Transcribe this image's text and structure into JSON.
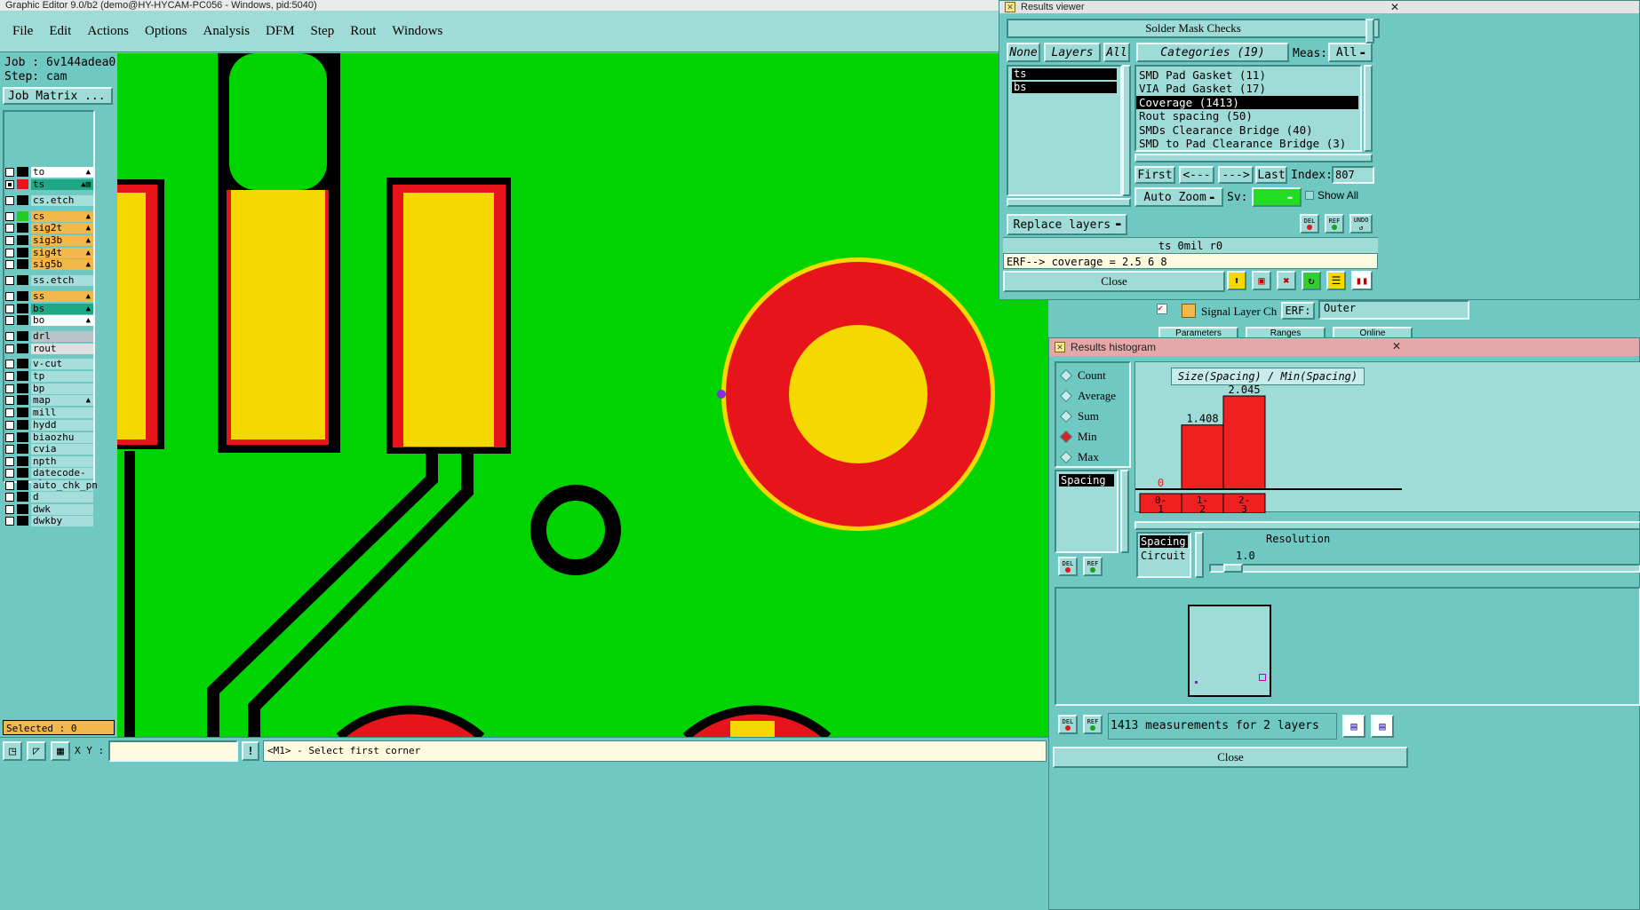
{
  "app": {
    "title": "Graphic Editor 9.0/b2 (demo@HY-HYCAM-PC056 - Windows, pid:5040)"
  },
  "menu": [
    "File",
    "Edit",
    "Actions",
    "Options",
    "Analysis",
    "DFM",
    "Step",
    "Rout",
    "Windows"
  ],
  "job": {
    "job_label": "Job : 6v144adea0",
    "step_label": "Step: cam",
    "matrix_button": "Job Matrix ..."
  },
  "layers": [
    {
      "name": "to",
      "color": "#ffffff",
      "sw": "#000000",
      "tag": "▲"
    },
    {
      "name": "ts",
      "color": "#1fa883",
      "sw": "#e8141b",
      "tag": "▲▧",
      "checked": true
    },
    {
      "name": "cs.etch",
      "color": "#a5dedb",
      "sw": "#000000",
      "tag": ""
    },
    {
      "name": "cs",
      "color": "#f2b84c",
      "sw": "#22cc22",
      "tag": "▲"
    },
    {
      "name": "sig2t",
      "color": "#f2b84c",
      "sw": "#000000",
      "tag": "▲"
    },
    {
      "name": "sig3b",
      "color": "#f2b84c",
      "sw": "#000000",
      "tag": "▲"
    },
    {
      "name": "sig4t",
      "color": "#f2b84c",
      "sw": "#000000",
      "tag": "▲"
    },
    {
      "name": "sig5b",
      "color": "#f2b84c",
      "sw": "#000000",
      "tag": "▲"
    },
    {
      "name": "ss.etch",
      "color": "#a5dedb",
      "sw": "#000000",
      "tag": ""
    },
    {
      "name": "ss",
      "color": "#f2b84c",
      "sw": "#000000",
      "tag": "▲"
    },
    {
      "name": "bs",
      "color": "#1fa883",
      "sw": "#000000",
      "tag": "▲"
    },
    {
      "name": "bo",
      "color": "#ffffff",
      "sw": "#000000",
      "tag": "▲"
    },
    {
      "name": "drl",
      "color": "#b8c4c6",
      "sw": "#000000",
      "tag": ""
    },
    {
      "name": "rout",
      "color": "#e0e0e0",
      "sw": "#000000",
      "tag": ""
    },
    {
      "name": "v-cut",
      "color": "#a5dedb",
      "sw": "#000000",
      "tag": ""
    },
    {
      "name": "tp",
      "color": "#a5dedb",
      "sw": "#000000",
      "tag": ""
    },
    {
      "name": "bp",
      "color": "#a5dedb",
      "sw": "#000000",
      "tag": ""
    },
    {
      "name": "map",
      "color": "#a5dedb",
      "sw": "#000000",
      "tag": "▲"
    },
    {
      "name": "mill",
      "color": "#a5dedb",
      "sw": "#000000",
      "tag": ""
    },
    {
      "name": "hydd",
      "color": "#a5dedb",
      "sw": "#000000",
      "tag": ""
    },
    {
      "name": "biaozhu",
      "color": "#a5dedb",
      "sw": "#000000",
      "tag": ""
    },
    {
      "name": "cvia",
      "color": "#a5dedb",
      "sw": "#000000",
      "tag": ""
    },
    {
      "name": "npth",
      "color": "#a5dedb",
      "sw": "#000000",
      "tag": ""
    },
    {
      "name": "datecode-pbe",
      "color": "#a5dedb",
      "sw": "#000000",
      "tag": ""
    },
    {
      "name": "auto_chk_pn",
      "color": "#a5dedb",
      "sw": "#000000",
      "tag": ""
    },
    {
      "name": "d",
      "color": "#a5dedb",
      "sw": "#000000",
      "tag": ""
    },
    {
      "name": "dwk",
      "color": "#a5dedb",
      "sw": "#000000",
      "tag": ""
    },
    {
      "name": "dwkby",
      "color": "#a5dedb",
      "sw": "#000000",
      "tag": ""
    }
  ],
  "status": {
    "selected": "Selected : 0",
    "xy_label": "X Y :",
    "xy_value": "",
    "prompt": "<M1> - Select first corner"
  },
  "results_viewer": {
    "title": "Results viewer",
    "header": "Solder Mask Checks",
    "none_btn": "None",
    "layers_btn": "Layers",
    "all_btn": "All",
    "layer_list": [
      "ts",
      "bs"
    ],
    "categories_label": "Categories (19)",
    "meas_label": "Meas:",
    "meas_value": "All",
    "categories": [
      "SMD Pad Gasket (11)",
      "VIA Pad Gasket (17)",
      "Coverage (1413)",
      "Rout spacing (50)",
      "SMDs Clearance Bridge (40)",
      "SMD to Pad Clearance Bridge (3)"
    ],
    "selected_category": 2,
    "first": "First",
    "prev": "<---",
    "next": "--->",
    "last": "Last",
    "index_label": "Index:",
    "index_value": "807",
    "auto_zoom": "Auto Zoom",
    "sv_label": "Sv:",
    "show_all": "Show All",
    "replace_layers": "Replace layers",
    "del": "DEL",
    "ref": "REF",
    "undo": "UNDO",
    "info_line": "ts 0mil  r0",
    "erf_line": "ERF--> coverage = 2.5 6 8",
    "close": "Close"
  },
  "signal_strip": {
    "name": "Signal Layer Ch",
    "erf_label": "ERF:",
    "erf_value": "Outer",
    "tabs": [
      "Parameters",
      "Ranges",
      "Online"
    ]
  },
  "histogram": {
    "title": "Results histogram",
    "modes": [
      "Count",
      "Average",
      "Sum",
      "Min",
      "Max"
    ],
    "selected_mode": 3,
    "param_list": [
      "Spacing"
    ],
    "chart_title": "Size(Spacing) / Min(Spacing)",
    "del": "DEL",
    "ref": "REF",
    "spacing_opts": [
      "Spacing",
      "Circuit"
    ],
    "resolution_label": "Resolution",
    "resolution_value": "1.0",
    "summary": "1413 measurements for 2 layers",
    "close": "Close"
  },
  "chart_data": {
    "type": "bar",
    "title": "Size(Spacing) / Min(Spacing)",
    "categories": [
      "0-1",
      "1-2",
      "2-3"
    ],
    "values": [
      0,
      1.408,
      2.045
    ],
    "value_labels": [
      "0",
      "1.408",
      "2.045"
    ],
    "colors": {
      "bar": "#ee2020"
    }
  }
}
